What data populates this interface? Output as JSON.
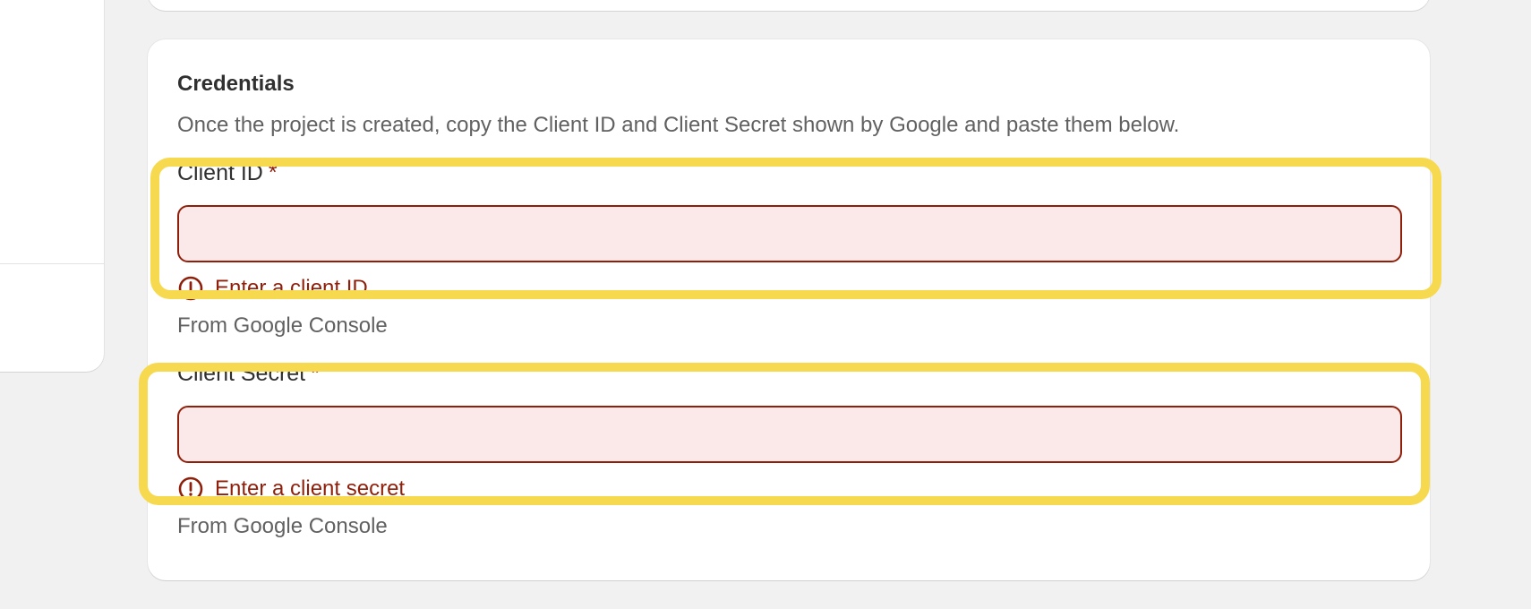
{
  "credentials": {
    "title": "Credentials",
    "description": "Once the project is created, copy the Client ID and Client Secret shown by Google and paste them below.",
    "required_marker": "*",
    "fields": [
      {
        "label": "Client ID",
        "value": "",
        "placeholder": "",
        "error": "Enter a client ID",
        "help": "From Google Console"
      },
      {
        "label": "Client Secret",
        "value": "",
        "placeholder": "",
        "error": "Enter a client secret",
        "help": "From Google Console"
      }
    ]
  },
  "icons": {
    "error": "alert-circle-icon"
  },
  "colors": {
    "background": "#f1f1f1",
    "card": "#ffffff",
    "error": "#8e1f0b",
    "input_error_fill": "#fbe9e9",
    "highlight": "#f6d94f",
    "muted_text": "#616161"
  }
}
